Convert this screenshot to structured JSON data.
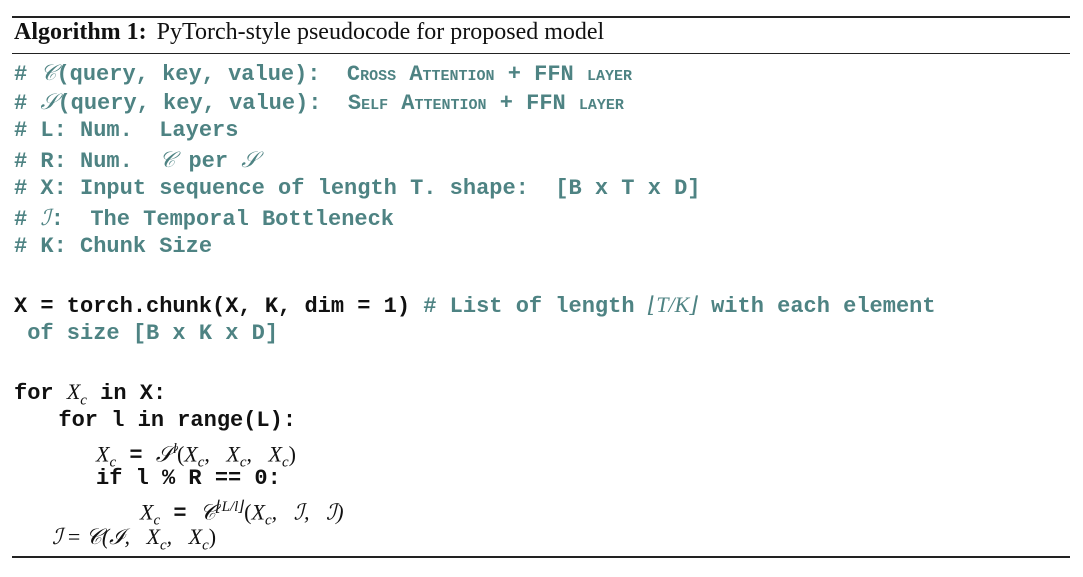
{
  "caption": {
    "label": "Algorithm 1:",
    "title": "PyTorch-style pseudocode for proposed model"
  },
  "comments": {
    "c_def_hash": "# ",
    "c_sym": "𝒞",
    "c_def_args": "(query, key, value):  ",
    "c_def_desc": "Cross Attention + FFN layer",
    "s_def_hash": "# ",
    "s_sym": "𝒮",
    "s_def_args": "(query, key, value):  ",
    "s_def_desc": "Self Attention + FFN layer",
    "l_line": "# L: Num.  Layers",
    "r_pre": "# R: Num.  ",
    "r_c": "𝒞",
    "r_mid": " per ",
    "r_s": "𝒮",
    "x_line": "# X: Input sequence of length T. shape:  [B x T x D]",
    "i_hash": "# ",
    "i_sym": "ℐ",
    "i_rest": ":  The Temporal Bottleneck",
    "k_line": "# K: Chunk Size"
  },
  "code": {
    "chunk_code": "X = torch.chunk(X, K, dim = 1) ",
    "chunk_cmt_pre": "# List of length ",
    "chunk_floor": "⌊T/K⌋",
    "chunk_cmt_post": " with each element",
    "chunk_cont": " of size [B x K x D]",
    "for1_pre": "for ",
    "for1_var": "X",
    "for1_sub": "c",
    "for1_post": " in X:",
    "for2": "  for l in range(L):",
    "a1_var": "X",
    "a1_sub": "c",
    "a1_eq": " = ",
    "a1_s": "𝒮",
    "a1_sup": "l",
    "a1_args": "(X",
    "a1_args_sub": "c",
    "a1_args2": ",   X",
    "a1_args2_sub": "c",
    "a1_args3": ",   X",
    "a1_args3_sub": "c",
    "a1_close": ")",
    "if_line": "if l % R == 0:",
    "a2_var": "X",
    "a2_sub": "c",
    "a2_eq": " = ",
    "a2_c": "𝒞",
    "a2_sup": "⌊L/l⌋",
    "a2_args": "(X",
    "a2_args_sub": "c",
    "a2_rest": ",   ℐ,   ℐ)",
    "last_i": "ℐ",
    "last_eq": " = ",
    "last_c": "𝒞",
    "last_args": "(ℐ,   X",
    "last_sub1": "c",
    "last_args2": ",   X",
    "last_sub2": "c",
    "last_close": ")"
  }
}
